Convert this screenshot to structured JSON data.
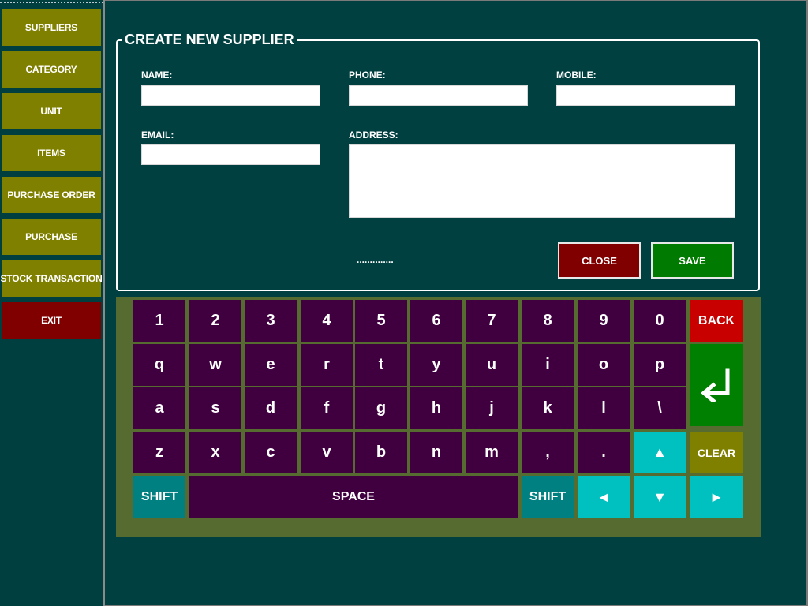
{
  "sidebar": {
    "items": [
      {
        "label": "SUPPLIERS"
      },
      {
        "label": "CATEGORY"
      },
      {
        "label": "UNIT"
      },
      {
        "label": "ITEMS"
      },
      {
        "label": "PURCHASE ORDER"
      },
      {
        "label": "PURCHASE"
      },
      {
        "label": "STOCK TRANSACTION"
      },
      {
        "label": "EXIT"
      }
    ]
  },
  "form": {
    "title": "CREATE NEW SUPPLIER",
    "name_label": "NAME:",
    "phone_label": "PHONE:",
    "mobile_label": "MOBILE:",
    "email_label": "EMAIL:",
    "address_label": "ADDRESS:",
    "name_value": "",
    "phone_value": "",
    "mobile_value": "",
    "email_value": "",
    "address_value": "",
    "status_text": "..............",
    "close_label": "CLOSE",
    "save_label": "SAVE"
  },
  "keyboard": {
    "row1": [
      "1",
      "2",
      "3",
      "4",
      "5",
      "6",
      "7",
      "8",
      "9",
      "0"
    ],
    "row2": [
      "q",
      "w",
      "e",
      "r",
      "t",
      "y",
      "u",
      "i",
      "o",
      "p"
    ],
    "row3": [
      "a",
      "s",
      "d",
      "f",
      "g",
      "h",
      "j",
      "k",
      "l",
      "\\"
    ],
    "row4": [
      "z",
      "x",
      "c",
      "v",
      "b",
      "n",
      "m",
      ",",
      "."
    ],
    "back_label": "BACK",
    "clear_label": "CLEAR",
    "shift_label": "SHIFT",
    "space_label": "SPACE",
    "up": "▲",
    "down": "▼",
    "left": "◄",
    "right": "►"
  },
  "colors": {
    "background": "#004040",
    "sidebar_button": "#808000",
    "exit_button": "#800000",
    "close_button": "#800000",
    "save_button": "#007a00",
    "key": "#400040",
    "keyboard_panel": "#556b2f",
    "shift_key": "#008080",
    "arrow_key": "#00c0c0",
    "back_key": "#c80000",
    "enter_key": "#008000"
  }
}
